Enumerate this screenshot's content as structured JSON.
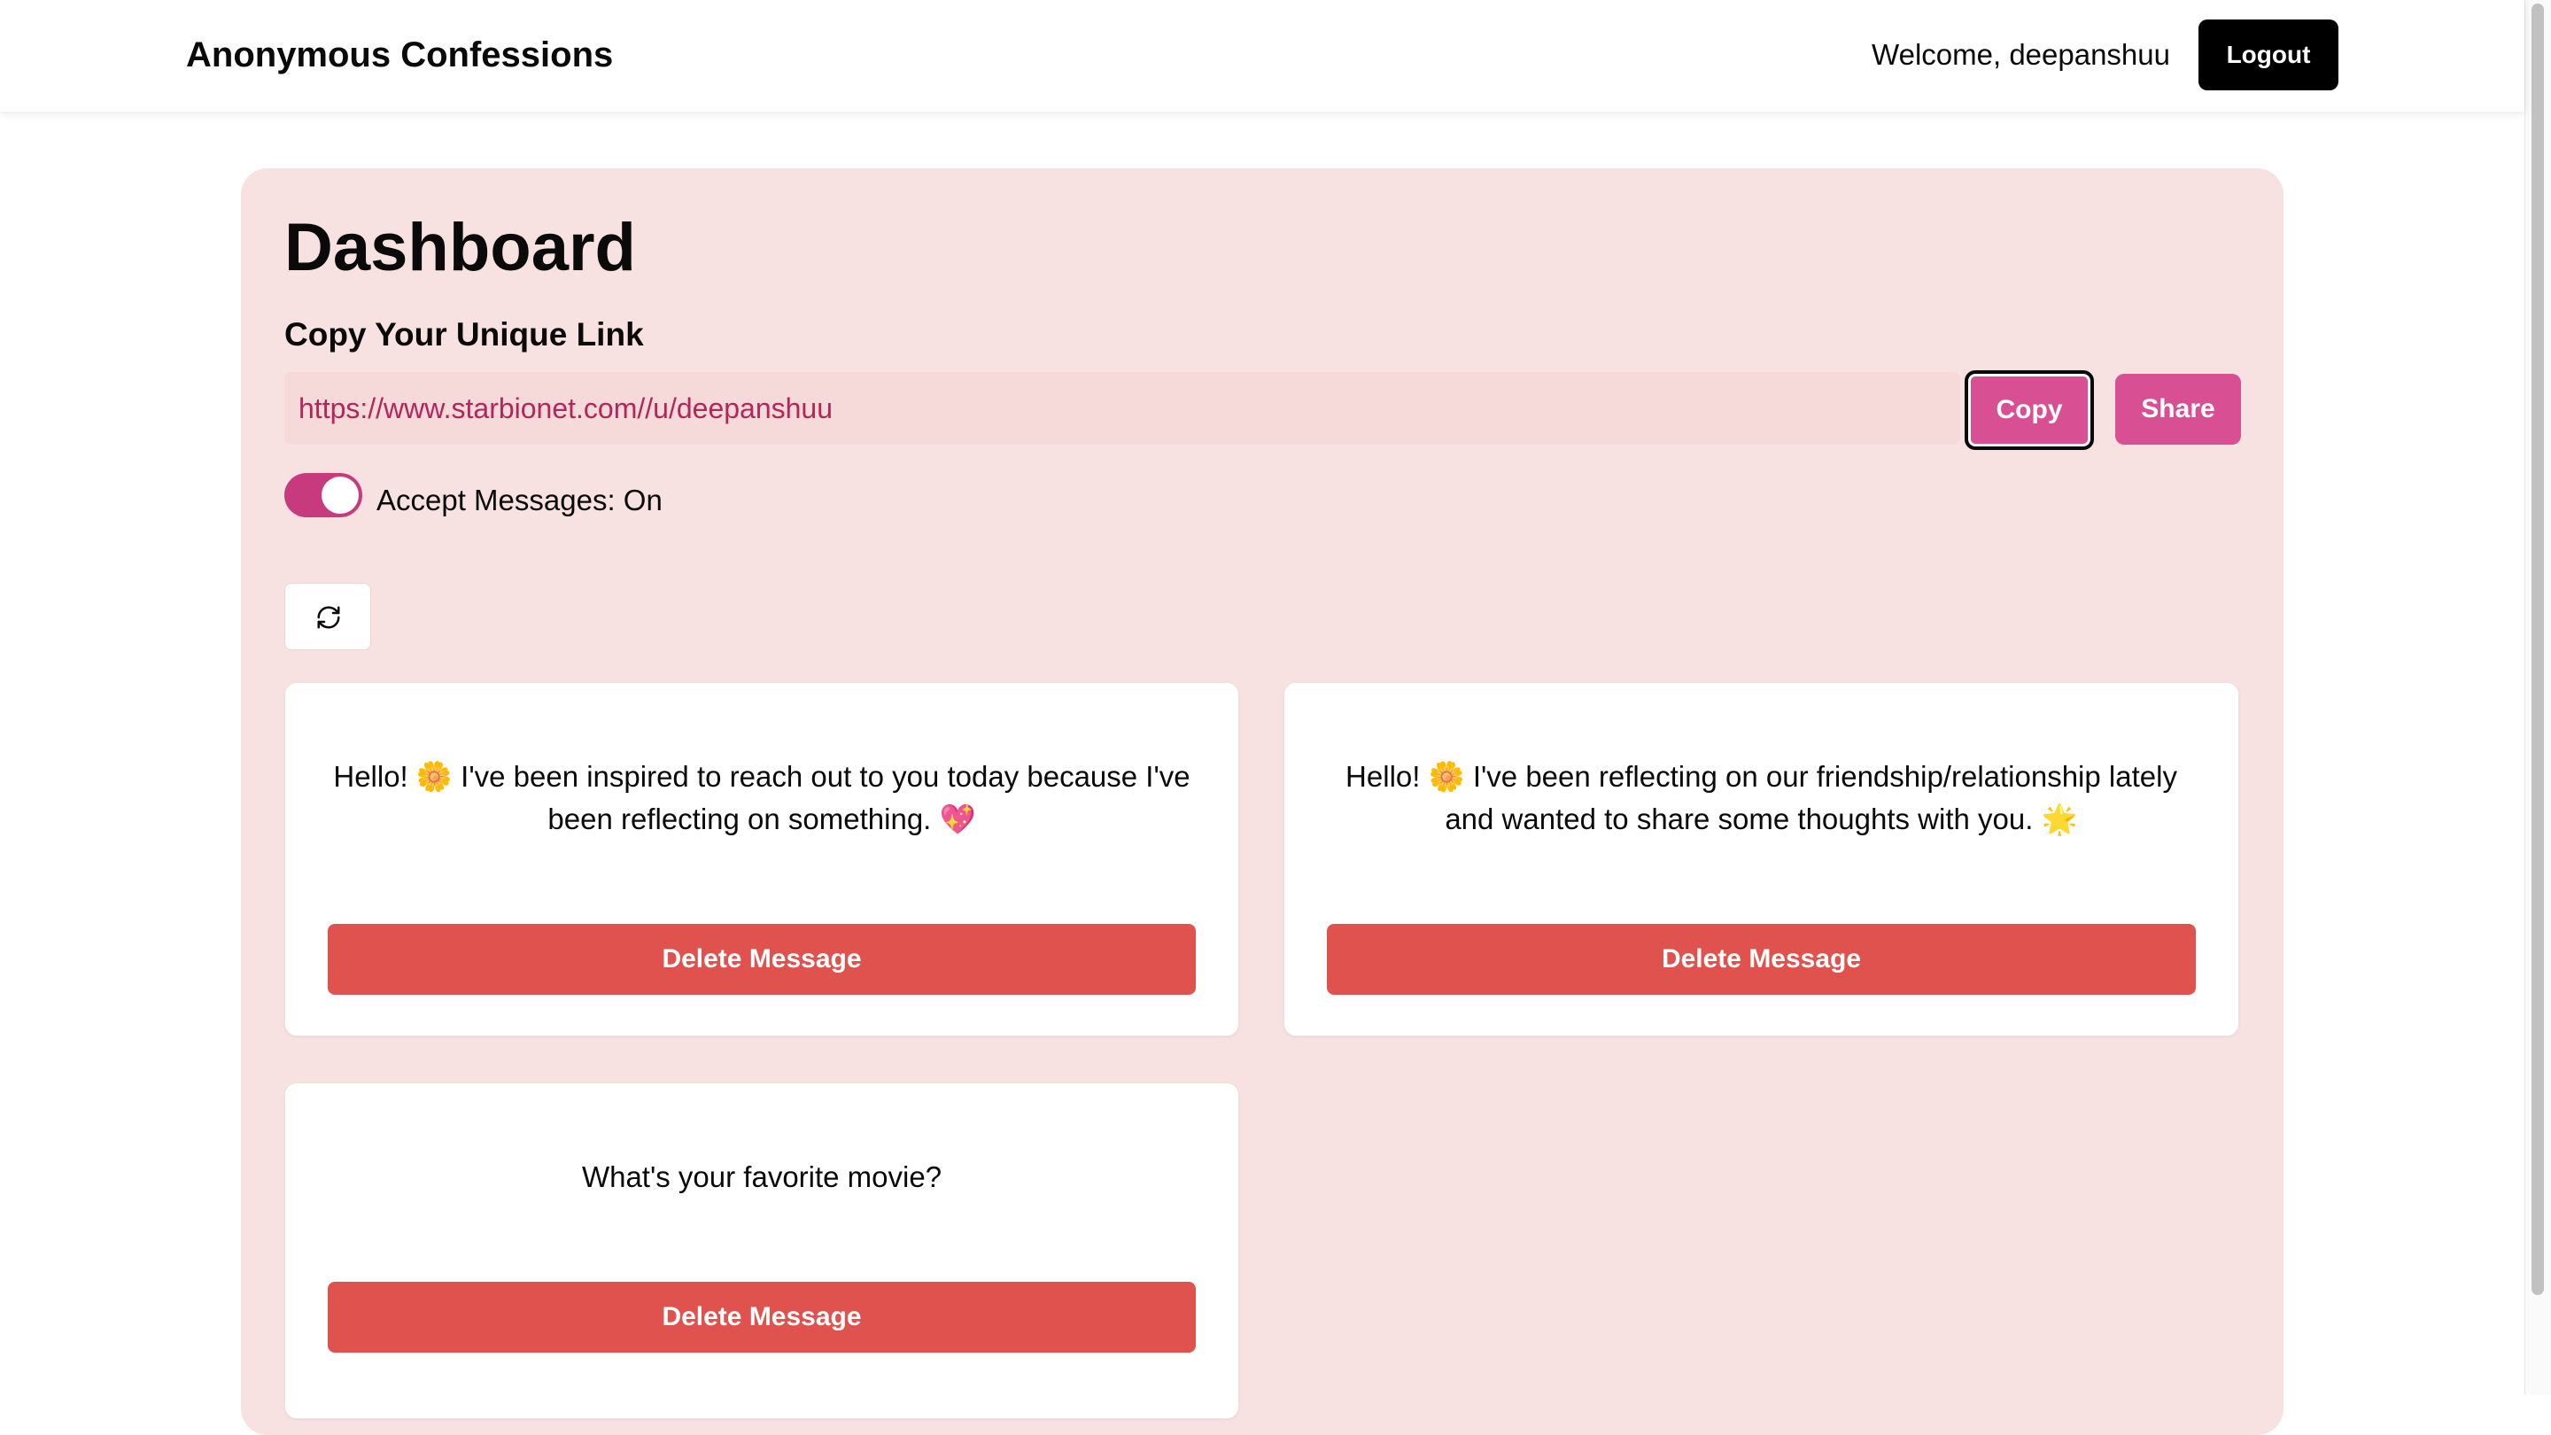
{
  "navbar": {
    "brand": "Anonymous Confessions",
    "welcome": "Welcome, deepanshuu",
    "logout_label": "Logout"
  },
  "dashboard": {
    "title": "Dashboard",
    "link_section_title": "Copy Your Unique Link",
    "unique_link": "https://www.starbionet.com//u/deepanshuu",
    "copy_label": "Copy",
    "share_label": "Share",
    "accept_messages_label": "Accept Messages: On",
    "accept_messages_on": true,
    "refresh_icon": "refresh-icon"
  },
  "messages": [
    {
      "text": "Hello! 🌼 I've been inspired to reach out to you today because I've been reflecting on something. 💖",
      "delete_label": "Delete Message"
    },
    {
      "text": "Hello! 🌼 I've been reflecting on our friendship/relationship lately and wanted to share some thoughts with you. 🌟",
      "delete_label": "Delete Message"
    },
    {
      "text": "What's your favorite movie?",
      "delete_label": "Delete Message"
    }
  ],
  "colors": {
    "panel_bg": "#f7e1e1",
    "accent_pink": "#d94f94",
    "toggle_on": "#c73a7e",
    "delete_red": "#df524d",
    "link_text": "#b5245a"
  }
}
